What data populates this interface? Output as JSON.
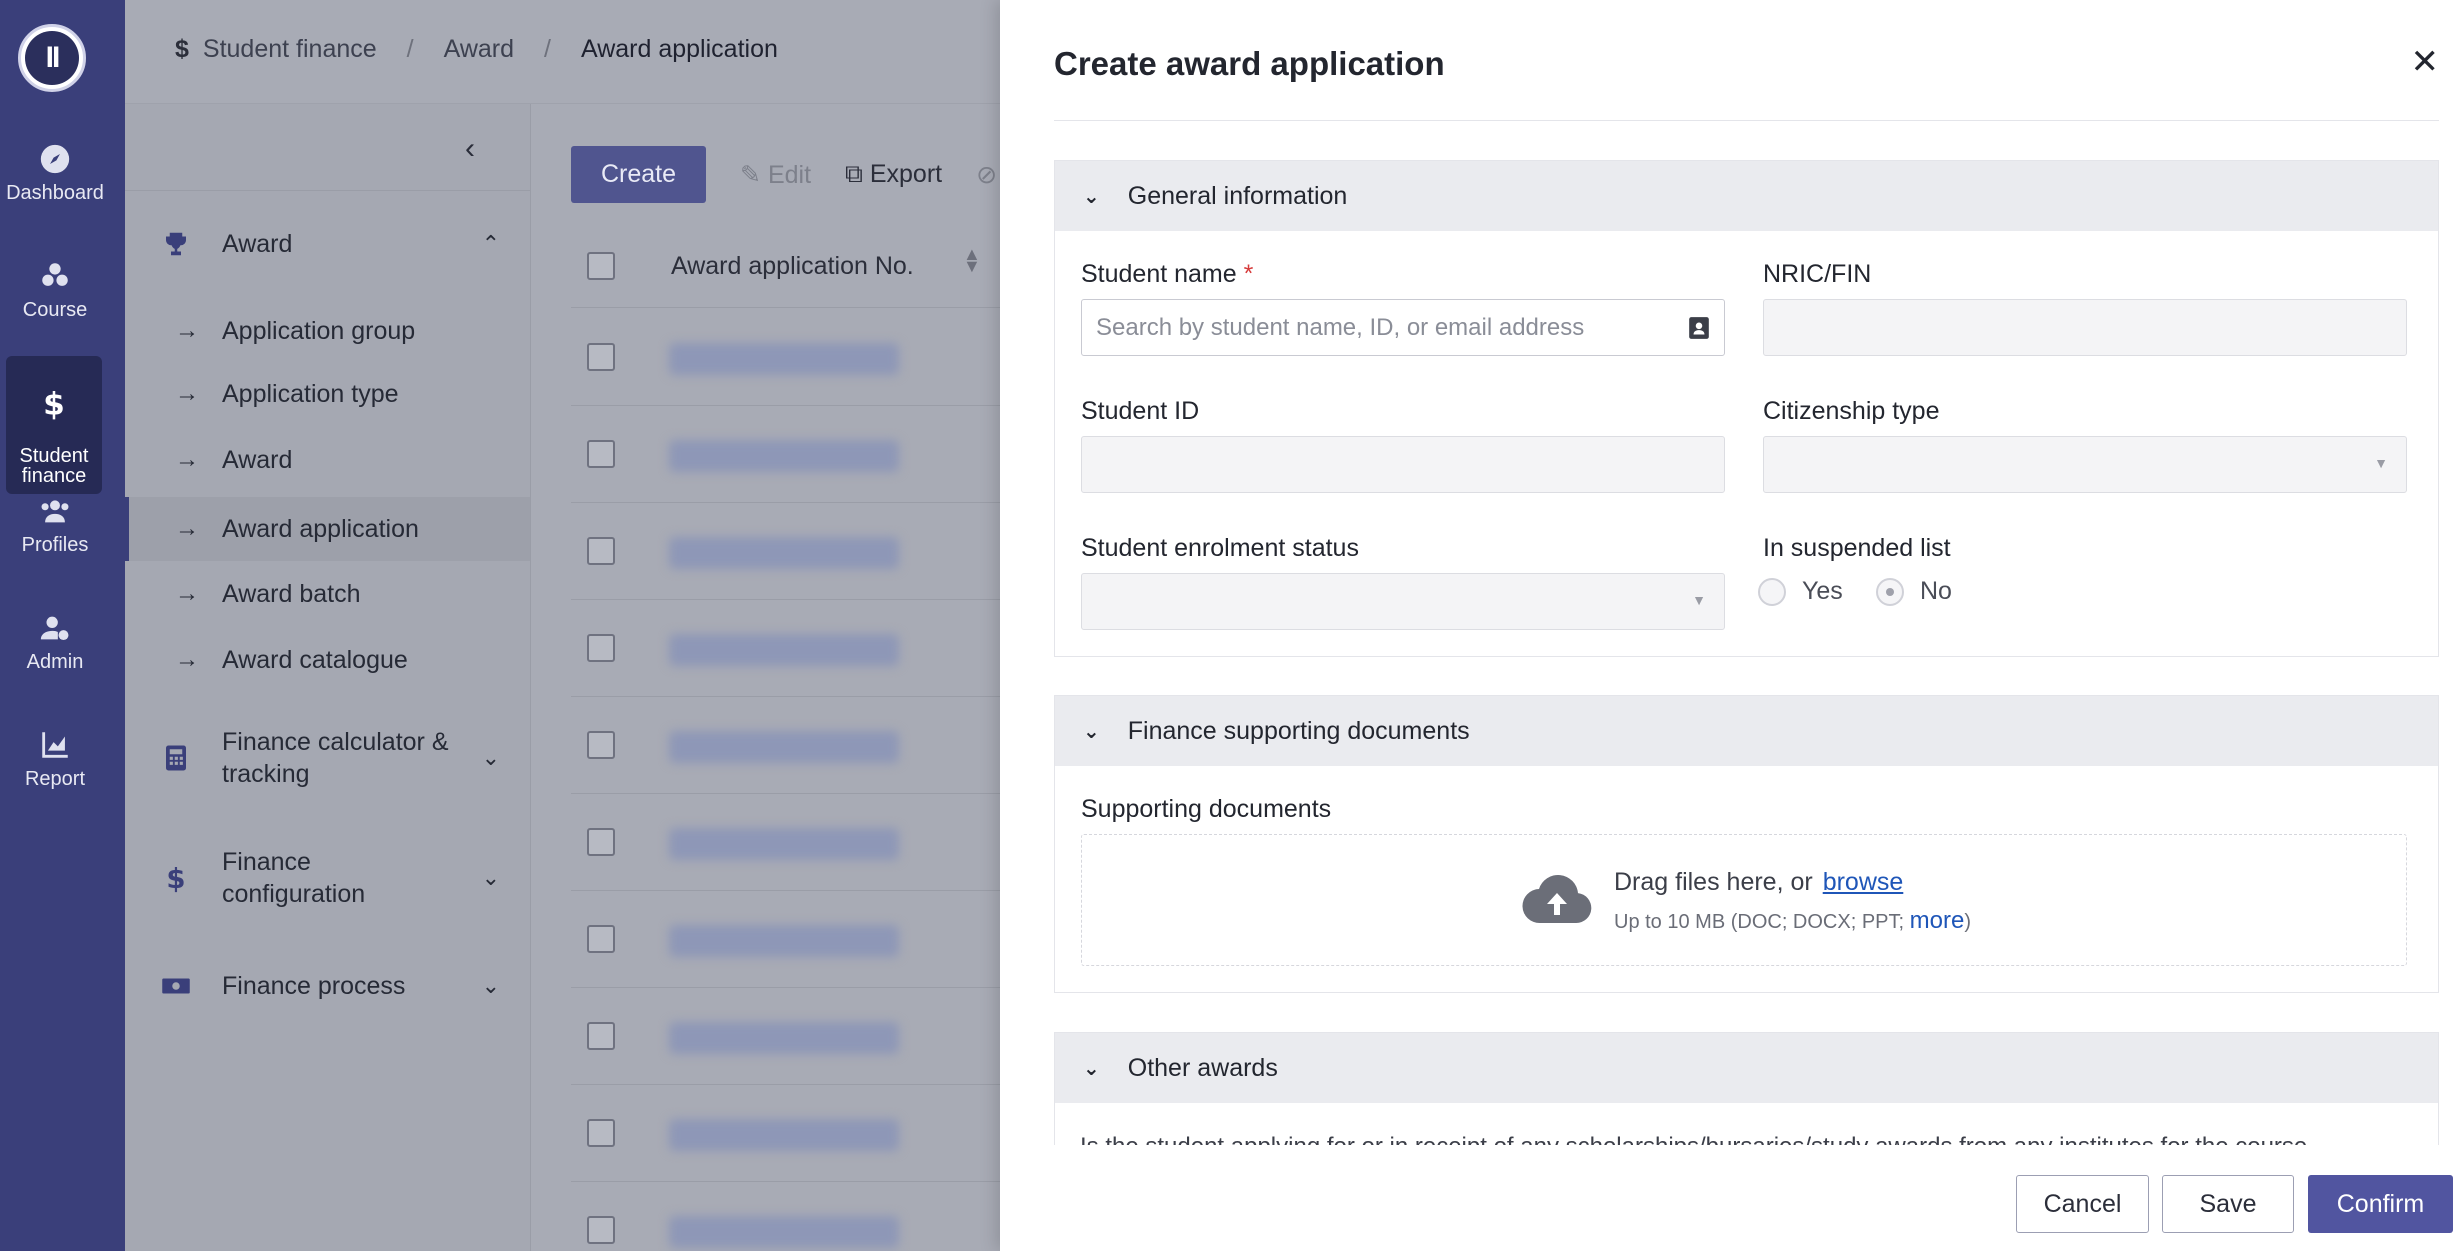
{
  "rail": {
    "items": [
      {
        "label": "Dashboard",
        "icon": "compass-icon"
      },
      {
        "label": "Course",
        "icon": "blocks-icon"
      },
      {
        "label": "Student\nfinance",
        "icon": "dollar-icon"
      },
      {
        "label": "Profiles",
        "icon": "people-icon"
      },
      {
        "label": "Admin",
        "icon": "user-gear-icon"
      },
      {
        "label": "Report",
        "icon": "chart-icon"
      }
    ]
  },
  "breadcrumb": {
    "items": [
      "Student finance",
      "Award",
      "Award application"
    ]
  },
  "subnav": {
    "award_group": "Award",
    "award_items": [
      "Application group",
      "Application type",
      "Award",
      "Award application",
      "Award batch",
      "Award catalogue"
    ],
    "groups": [
      "Finance calculator & tracking",
      "Finance configuration",
      "Finance process"
    ]
  },
  "toolbar": {
    "create": "Create",
    "edit": "Edit",
    "export": "Export"
  },
  "table": {
    "column_header": "Award application No."
  },
  "drawer": {
    "title": "Create award application",
    "general": {
      "heading": "General information",
      "student_name_label": "Student name",
      "student_name_placeholder": "Search by student name, ID, or email address",
      "nric_label": "NRIC/FIN",
      "student_id_label": "Student ID",
      "citizenship_label": "Citizenship type",
      "enrolment_label": "Student enrolment status",
      "suspended_label": "In suspended list",
      "yes": "Yes",
      "no": "No"
    },
    "finance_docs": {
      "heading": "Finance supporting documents",
      "supporting_label": "Supporting documents",
      "drag_text": "Drag files here, or",
      "browse": "browse",
      "limit_text": "Up to 10 MB (DOC; DOCX; PPT;",
      "more": "more",
      "close_paren": ")"
    },
    "other_awards": {
      "heading": "Other awards",
      "question": "Is the student applying for or in receipt of any scholarships/bursaries/study awards from any institutes for the course"
    },
    "footer": {
      "cancel": "Cancel",
      "save": "Save",
      "confirm": "Confirm"
    }
  }
}
